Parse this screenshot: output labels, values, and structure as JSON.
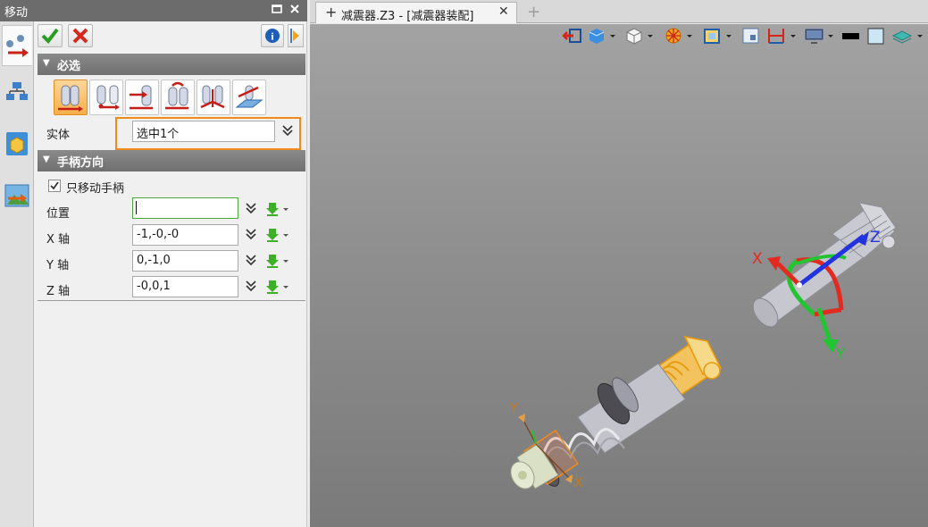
{
  "panel": {
    "title": "移动",
    "pin_icon": "pin-icon",
    "close_icon": "close-icon",
    "info_label": "i"
  },
  "required": {
    "title": "必选",
    "entity_label": "实体",
    "entity_value": "选中1个"
  },
  "handle": {
    "title": "手柄方向",
    "move_handle_only_label": "只移动手柄",
    "move_handle_only_checked": true,
    "position_label": "位置",
    "position_value": "",
    "x_label": "X 轴",
    "x_value": "-1,-0,-0",
    "y_label": "Y 轴",
    "y_value": "0,-1,0",
    "z_label": "Z 轴",
    "z_value": "-0,0,1"
  },
  "document": {
    "tab_label": "减震器.Z3 - [减震器装配]"
  },
  "viewport": {
    "axis_labels": {
      "x": "X",
      "y": "Y",
      "z": "Z"
    },
    "small_triad": {
      "x": "X",
      "y": "Y"
    },
    "colors": {
      "x_axis": "#e22a20",
      "y_axis": "#22c431",
      "z_axis": "#2233e0",
      "selected": "#f0b020",
      "highlight_box": "#f08a1c"
    }
  }
}
